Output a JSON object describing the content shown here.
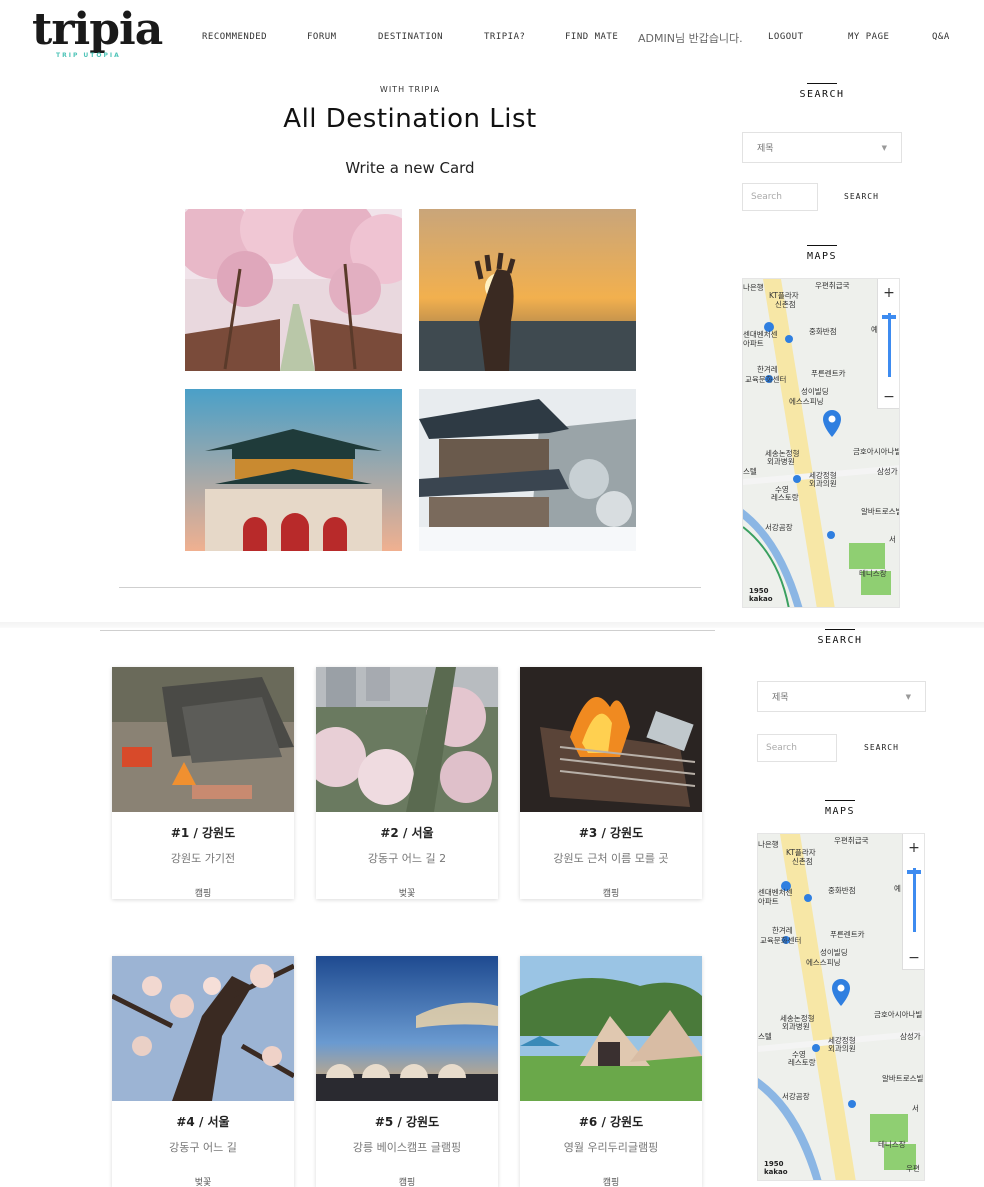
{
  "nav": {
    "logo": "tripia",
    "logo_sub": "TRIP UTOPIA",
    "items": [
      "RECOMMENDED",
      "FORUM",
      "DESTINATION",
      "TRIPIA?",
      "FIND MATE"
    ],
    "greeting": "ADMIN님 반갑습니다.",
    "logout": "LOGOUT",
    "mypage": "MY PAGE",
    "qna": "Q&A"
  },
  "main": {
    "eyebrow": "WITH TRIPIA",
    "title": "All Destination List",
    "write_link": "Write a new Card"
  },
  "sidebar": {
    "search_title": "SEARCH",
    "select_value": "제목",
    "search_placeholder": "Search",
    "search_button": "SEARCH",
    "maps_title": "MAPS",
    "map_labels": [
      "우편취급국",
      "KT플라자",
      "신촌점",
      "중화반점",
      "한겨레",
      "교육문화센터",
      "푸른렌트카",
      "성이빌딩",
      "에스스피닝",
      "세송논정형",
      "외과병원",
      "금호아시아나빌",
      "세강정형",
      "외과의원",
      "삼성가",
      "수영",
      "레스토랑",
      "알바트로스빌",
      "서강곰장",
      "테니스장",
      "나은행",
      "센대벤처센",
      "아파트",
      "스텔",
      "예",
      "서",
      "우편"
    ],
    "map_brand": "kakao",
    "map_year": "1950",
    "zoom_in": "+",
    "zoom_out": "−"
  },
  "cards": [
    {
      "title": "#1 / 강원도",
      "desc": "강원도 가기전",
      "tag": "캠핑"
    },
    {
      "title": "#2 / 서울",
      "desc": "강동구 어느 길 2",
      "tag": "벚꽃"
    },
    {
      "title": "#3 / 강원도",
      "desc": "강원도 근처 이름 모를 곳",
      "tag": "캠핑"
    },
    {
      "title": "#4 / 서울",
      "desc": "강동구 어느 길",
      "tag": "벚꽃"
    },
    {
      "title": "#5 / 강원도",
      "desc": "강릉 베이스캠프 글램핑",
      "tag": "캠핑"
    },
    {
      "title": "#6 / 강원도",
      "desc": "영월 우리두리글램핑",
      "tag": "캠핑"
    }
  ],
  "colors": {
    "accent": "#4fc4b8",
    "map_pin": "#2f7fe0",
    "road_main": "#f7e7a6",
    "park": "#8fcf72"
  }
}
